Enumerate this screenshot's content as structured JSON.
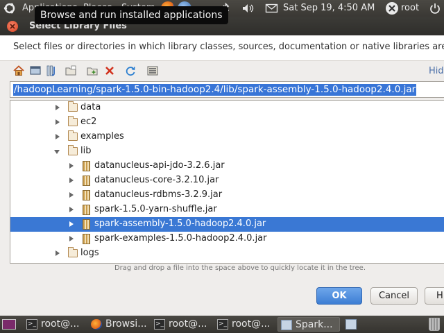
{
  "top_panel": {
    "menu_applications": "Applications",
    "menu_places": "Places",
    "menu_system": "System",
    "clock": "Sat Sep 19,  4:50 AM",
    "user": "root"
  },
  "tooltip": "Browse and run installed applications",
  "dialog": {
    "title": "Select Library Files",
    "description": "Select files or directories in which library classes, sources, documentation or native libraries are lo",
    "hide_label": "Hid",
    "path": "/hadoopLearning/spark-1.5.0-bin-hadoop2.4/lib/spark-assembly-1.5.0-hadoop2.4.0.jar",
    "tree": {
      "data": "data",
      "ec2": "ec2",
      "examples": "examples",
      "lib": "lib",
      "jar1": "datanucleus-api-jdo-3.2.6.jar",
      "jar2": "datanucleus-core-3.2.10.jar",
      "jar3": "datanucleus-rdbms-3.2.9.jar",
      "jar4": "spark-1.5.0-yarn-shuffle.jar",
      "jar5": "spark-assembly-1.5.0-hadoop2.4.0.jar",
      "jar6": "spark-examples-1.5.0-hadoop2.4.0.jar",
      "logs": "logs"
    },
    "dnd_hint": "Drag and drop a file into the space above to quickly locate it in the tree.",
    "ok": "OK",
    "cancel": "Cancel",
    "help": "H"
  },
  "taskbar": {
    "t1": "root@...",
    "t2": "Browsi...",
    "t3": "root@...",
    "t4": "root@...",
    "t5": "Spark..."
  },
  "colors": {
    "selection": "#3a78d4",
    "ok_button": "#3d7ed4",
    "panel": "#3c3b37"
  }
}
